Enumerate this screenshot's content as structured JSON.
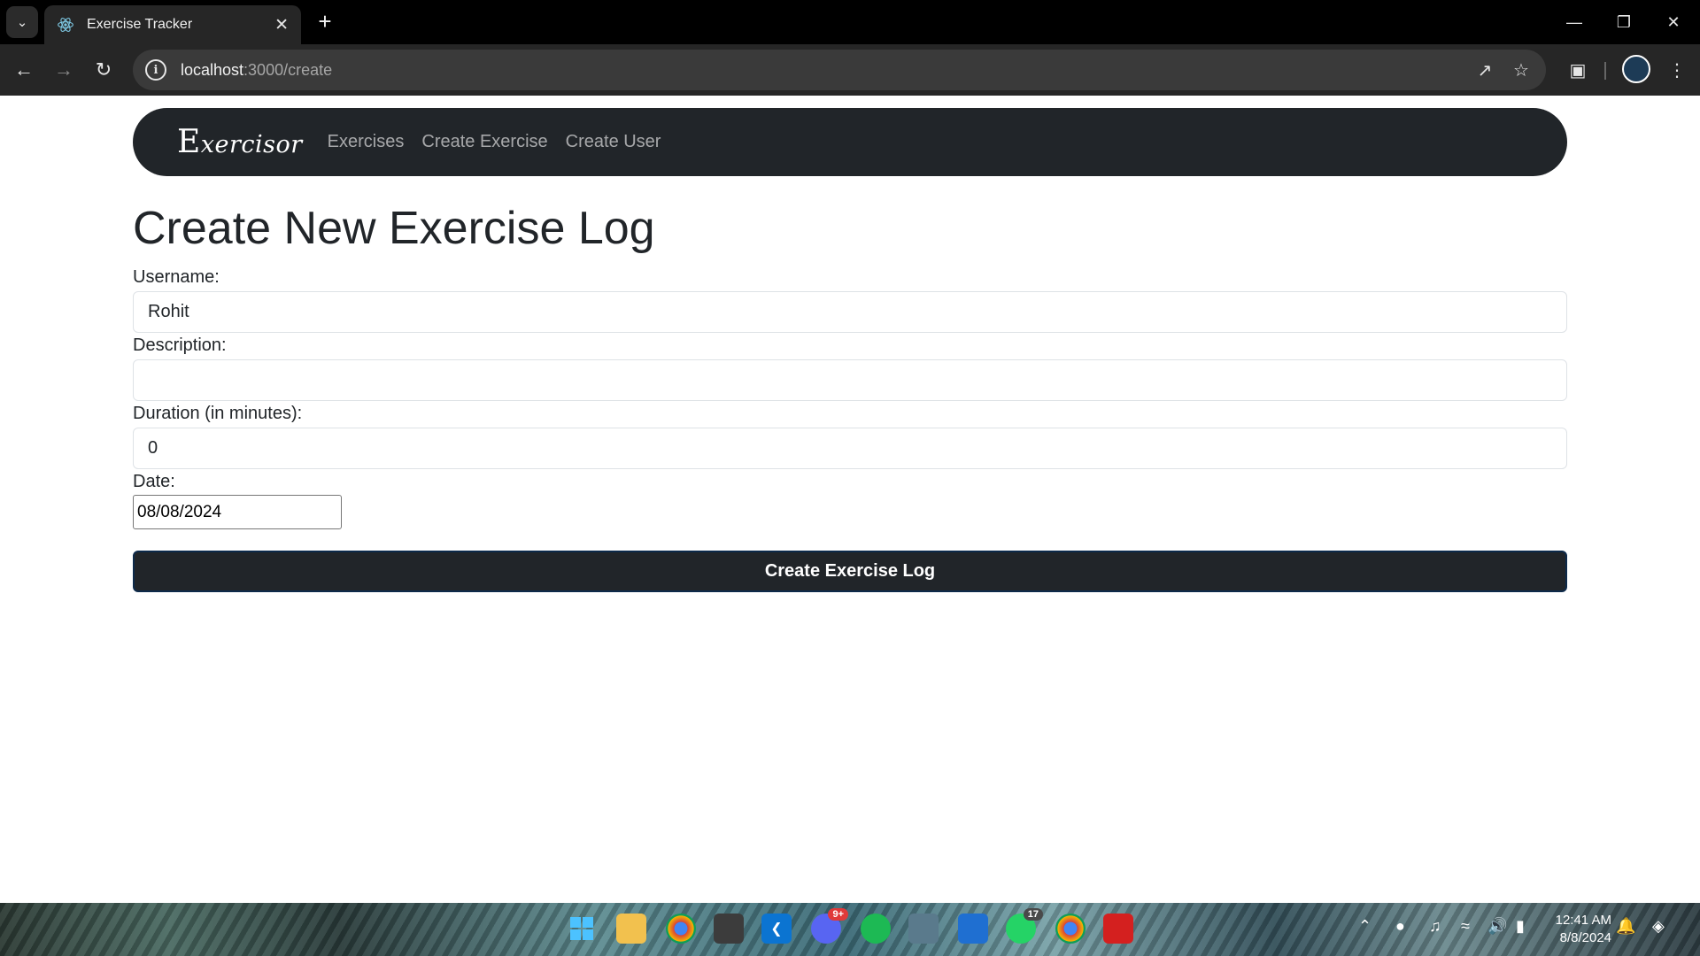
{
  "browser": {
    "tab_title": "Exercise Tracker",
    "url_host": "localhost",
    "url_path": ":3000/create"
  },
  "icons": {
    "tab_search": "chevron-down-icon",
    "favicon": "react-atom-icon",
    "tab_close": "close-icon",
    "new_tab": "plus-icon",
    "minimize": "minimize-icon",
    "restore": "restore-icon",
    "close_window": "close-icon",
    "back": "arrow-left-icon",
    "forward": "arrow-right-icon",
    "reload": "reload-icon",
    "site_info": "info-icon",
    "open_in_app": "open-external-icon",
    "bookmark": "star-icon",
    "extensions": "puzzle-icon",
    "menu": "more-vert-icon"
  },
  "navbar": {
    "brand_first": "E",
    "brand_rest": "xercisor",
    "links": [
      "Exercises",
      "Create Exercise",
      "Create User"
    ]
  },
  "form": {
    "title": "Create New Exercise Log",
    "username_label": "Username:",
    "username_value": "Rohit",
    "description_label": "Description:",
    "description_value": "",
    "duration_label": "Duration (in minutes):",
    "duration_value": "0",
    "date_label": "Date:",
    "date_value": "08/08/2024",
    "submit_label": "Create Exercise Log"
  },
  "taskbar": {
    "whatsapp_badge": "17",
    "discord_badge": "9+",
    "time": "12:41 AM",
    "date": "8/8/2024"
  },
  "colors": {
    "navbar_bg": "#212529",
    "button_bg": "#212529",
    "chrome_bg": "#262626"
  }
}
